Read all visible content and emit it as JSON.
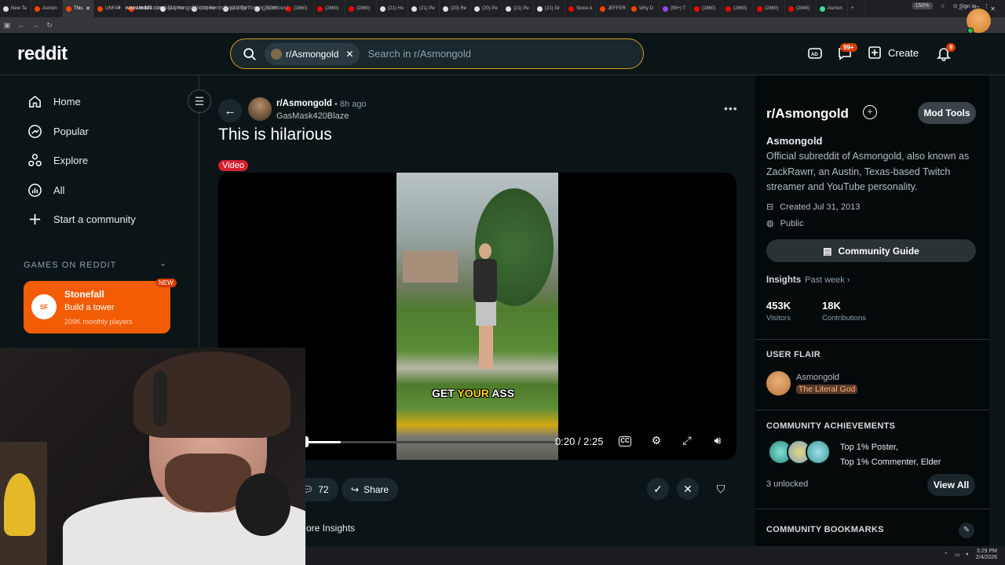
{
  "browser": {
    "tabs": [
      {
        "label": "New Ta",
        "color": "#e0e0e0"
      },
      {
        "label": "Asmon",
        "color": "#ff4500"
      },
      {
        "label": "This",
        "color": "#ff4500",
        "active": true
      },
      {
        "label": "UNFAT",
        "color": "#ff4500"
      },
      {
        "label": "Madelv",
        "color": "#ff4500"
      },
      {
        "label": "(21) Ho",
        "color": "#e0e0e0"
      },
      {
        "label": "(21) Ho",
        "color": "#e0e0e0"
      },
      {
        "label": "(21) Qu",
        "color": "#e0e0e0"
      },
      {
        "label": "(21) Mi",
        "color": "#e0e0e0"
      },
      {
        "label": "(2860)",
        "color": "#ff0000"
      },
      {
        "label": "(2860)",
        "color": "#ff0000"
      },
      {
        "label": "(2860)",
        "color": "#ff0000"
      },
      {
        "label": "(21) Ho",
        "color": "#e0e0e0"
      },
      {
        "label": "(21) Pe",
        "color": "#e0e0e0"
      },
      {
        "label": "(20) Re",
        "color": "#e0e0e0"
      },
      {
        "label": "(20) Pe",
        "color": "#e0e0e0"
      },
      {
        "label": "(21) Pe",
        "color": "#e0e0e0"
      },
      {
        "label": "(21) Gr",
        "color": "#e0e0e0"
      },
      {
        "label": "Since A",
        "color": "#ff0000"
      },
      {
        "label": "JEFFER",
        "color": "#ff4500"
      },
      {
        "label": "Why D",
        "color": "#ff4500"
      },
      {
        "label": "(99+) T",
        "color": "#9147ff"
      },
      {
        "label": "(2860)",
        "color": "#ff0000"
      },
      {
        "label": "(2860)",
        "color": "#ff0000"
      },
      {
        "label": "(2860)",
        "color": "#ff0000"
      },
      {
        "label": "(2845)",
        "color": "#ff0000"
      },
      {
        "label": "Asmon",
        "color": "#3ddc97"
      }
    ],
    "url_host": "www.reddit.com",
    "url_path": "/r/Asmongold/comments/1qvo49q/this_is_hilarious/",
    "zoom": "150%",
    "signin": "Sign in"
  },
  "header": {
    "logo": "reddit",
    "search_chip": "r/Asmongold",
    "search_placeholder": "Search in r/Asmongold",
    "chat_badge": "99+",
    "create_label": "Create",
    "notif_badge": "9"
  },
  "sidebar": {
    "items": [
      {
        "label": "Home",
        "icon": "home-icon"
      },
      {
        "label": "Popular",
        "icon": "popular-icon"
      },
      {
        "label": "Explore",
        "icon": "explore-icon"
      },
      {
        "label": "All",
        "icon": "all-icon"
      },
      {
        "label": "Start a community",
        "icon": "plus-icon"
      }
    ],
    "games_title": "GAMES ON REDDIT",
    "game": {
      "title": "Stonefall",
      "subtitle": "Build a tower",
      "players": "209K monthly players",
      "badge": "NEW",
      "logo_text": "SF"
    }
  },
  "post": {
    "subreddit": "r/Asmongold",
    "time": "• 8h ago",
    "author": "GasMask420Blaze",
    "title": "This is hilarious",
    "flair": "Video",
    "video": {
      "caption_white": "GET ",
      "caption_yellow": "YOUR",
      "caption_white2": " ASS",
      "time": "0:20 / 2:25",
      "progress": 0.138
    },
    "comments": "72",
    "share_label": "Share",
    "insights_label": "More Insights"
  },
  "community": {
    "title": "r/Asmongold",
    "mod_tools": "Mod Tools",
    "name": "Asmongold",
    "description": "Official subreddit of Asmongold, also known as ZackRawrr, an Austin, Texas-based Twitch streamer and YouTube personality.",
    "created": "Created Jul 31, 2013",
    "visibility": "Public",
    "guide_label": "Community Guide",
    "insights_title": "Insights",
    "insights_period": "Past week",
    "visitors_value": "453K",
    "visitors_label": "Visitors",
    "contrib_value": "18K",
    "contrib_label": "Contributions",
    "user_flair_title": "USER FLAIR",
    "flair_user": "Asmongold",
    "flair_tag": "The Literal God",
    "achievements_title": "COMMUNITY ACHIEVEMENTS",
    "achievements_line1": "Top 1% Poster,",
    "achievements_line2": "Top 1% Commenter, Elder",
    "unlocked": "3 unlocked",
    "view_all": "View All",
    "bookmarks_title": "COMMUNITY BOOKMARKS"
  },
  "taskbar": {
    "time": "3:29 PM",
    "date": "2/4/2026"
  }
}
